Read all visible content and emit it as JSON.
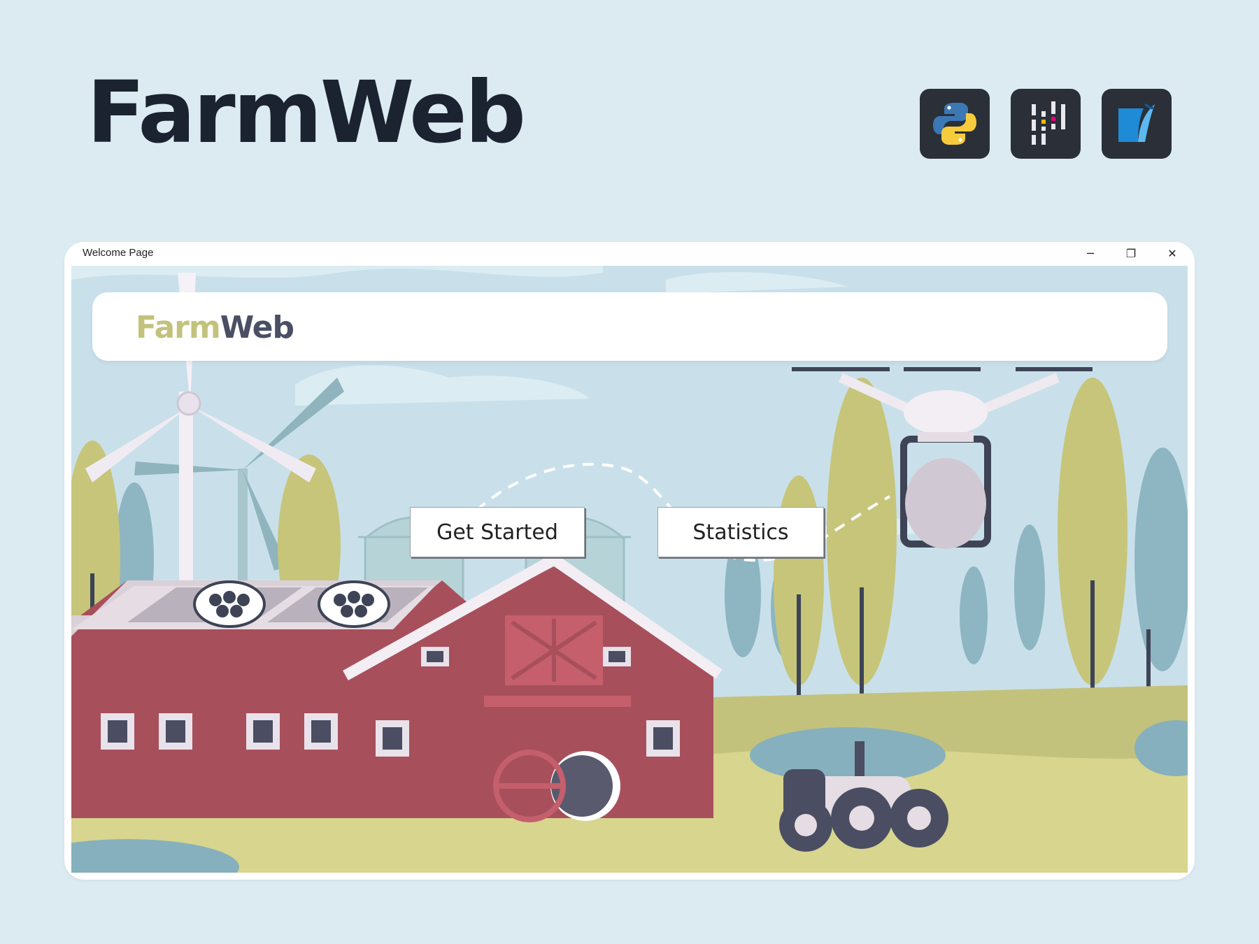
{
  "brand": {
    "title": "FarmWeb"
  },
  "tech_stack": [
    {
      "icon": "python-icon"
    },
    {
      "icon": "pandas-icon"
    },
    {
      "icon": "sqlite-icon"
    }
  ],
  "window": {
    "title": "Welcome Page",
    "controls": {
      "minimize": "─",
      "maximize": "❐",
      "close": "✕"
    }
  },
  "header": {
    "logo_part1": "Farm",
    "logo_part2": "Web"
  },
  "buttons": {
    "get_started": "Get Started",
    "statistics": "Statistics"
  },
  "colors": {
    "page_bg": "#dcebf2",
    "logo_accent": "#c3c27c",
    "logo_dark": "#4a4f63",
    "barn_red": "#a84f5c",
    "tree_green": "#c6c57a",
    "tree_blue": "#8db6c2"
  }
}
